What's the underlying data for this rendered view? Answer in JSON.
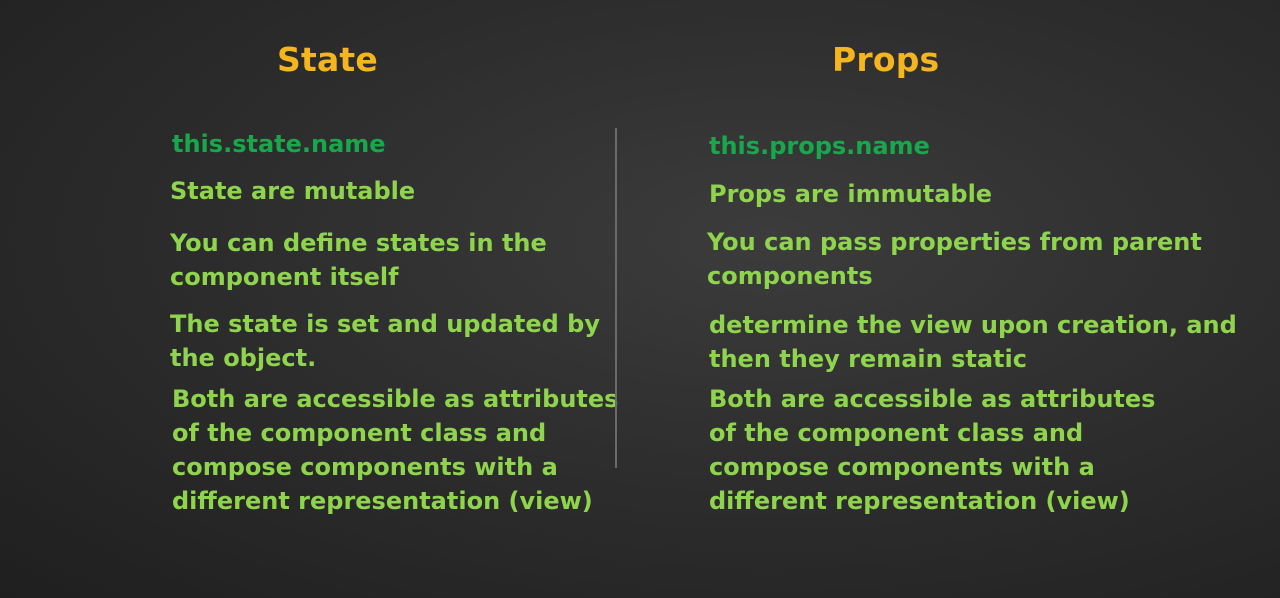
{
  "left": {
    "heading": "State",
    "code": "this.state.name",
    "points": [
      "State are mutable",
      "You can define states in the\ncomponent itself",
      "The state  is set and updated by\nthe object.",
      "Both are accessible as attributes\nof the component class  and\ncompose components with a\ndifferent representation (view)"
    ]
  },
  "right": {
    "heading": "Props",
    "code": "this.props.name",
    "points": [
      "Props are immutable",
      "You can pass properties from parent\ncomponents",
      "determine the view upon creation, and\nthen they remain static",
      "Both are accessible as attributes\nof the component class and\ncompose components with a\ndifferent representation (view)"
    ]
  },
  "colors": {
    "heading": "#f5b51f",
    "code": "#16a84a",
    "text": "#8ed44c",
    "divider": "#6a6a6a"
  }
}
